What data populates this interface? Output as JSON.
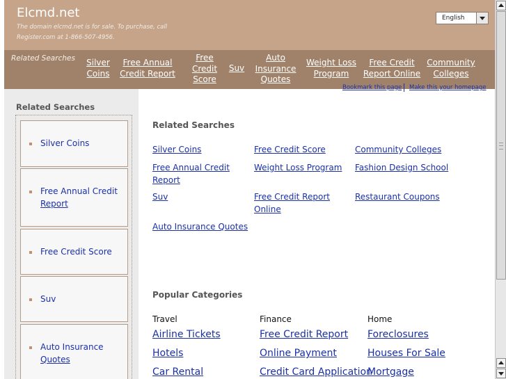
{
  "header": {
    "site_title": "Elcmd.net",
    "sale_note": "The domain elcmd.net is for sale. To purchase, call Register.com at 1-866-507-4956.",
    "language": "English"
  },
  "topnav": {
    "label": "Related Searches",
    "items": [
      {
        "label": "Silver Coins"
      },
      {
        "label": "Free Annual Credit Report"
      },
      {
        "label": "Free Credit Score"
      },
      {
        "label": "Suv"
      },
      {
        "label": "Auto Insurance Quotes"
      },
      {
        "label": "Weight Loss Program"
      },
      {
        "label": "Free Credit Report Online"
      },
      {
        "label": "Community Colleges"
      }
    ]
  },
  "utility": {
    "bookmark": "Bookmark this page",
    "homepage": "Make this your homepage"
  },
  "sidebar": {
    "heading": "Related Searches",
    "items": [
      {
        "label": "Silver Coins"
      },
      {
        "label": "Free Annual Credit",
        "label2": "Report"
      },
      {
        "label": "Free Credit Score"
      },
      {
        "label": "Suv"
      },
      {
        "label": "Auto Insurance",
        "label2": "Quotes"
      }
    ]
  },
  "main": {
    "related_heading": "Related Searches",
    "related": [
      {
        "label": "Silver Coins"
      },
      {
        "label": "Free Credit Score"
      },
      {
        "label": "Community Colleges"
      },
      {
        "label": "Free Annual Credit Report"
      },
      {
        "label": "Weight Loss Program"
      },
      {
        "label": "Fashion Design School"
      },
      {
        "label": "Suv"
      },
      {
        "label": "Free Credit Report Online"
      },
      {
        "label": "Restaurant Coupons"
      },
      {
        "label": "Auto Insurance Quotes"
      }
    ],
    "popular_heading": "Popular Categories",
    "categories": [
      {
        "title": "Travel",
        "links": [
          "Airline Tickets",
          "Hotels",
          "Car Rental"
        ]
      },
      {
        "title": "Finance",
        "links": [
          "Free Credit Report",
          "Online Payment",
          "Credit Card Application"
        ]
      },
      {
        "title": "Home",
        "links": [
          "Foreclosures",
          "Houses For Sale",
          "Mortgage"
        ]
      }
    ]
  }
}
